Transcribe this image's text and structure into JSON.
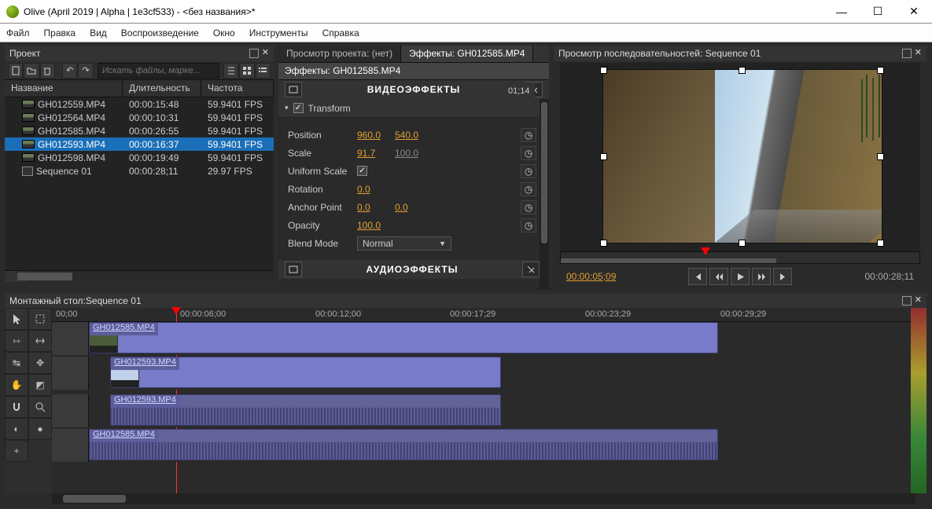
{
  "window": {
    "title": "Olive (April 2019 | Alpha | 1e3cf533) - <без названия>*"
  },
  "menu": [
    "Файл",
    "Правка",
    "Вид",
    "Воспроизведение",
    "Окно",
    "Инструменты",
    "Справка"
  ],
  "project": {
    "title": "Проект",
    "search_placeholder": "Искать файлы, марке...",
    "columns": [
      "Название",
      "Длительность",
      "Частота"
    ],
    "rows": [
      {
        "name": "GH012559.MP4",
        "dur": "00:00:15:48",
        "freq": "59.9401 FPS",
        "icon": "thumb",
        "sel": false
      },
      {
        "name": "GH012564.MP4",
        "dur": "00:00:10:31",
        "freq": "59.9401 FPS",
        "icon": "thumb",
        "sel": false
      },
      {
        "name": "GH012585.MP4",
        "dur": "00:00:26:55",
        "freq": "59.9401 FPS",
        "icon": "thumb",
        "sel": false
      },
      {
        "name": "GH012593.MP4",
        "dur": "00:00:16:37",
        "freq": "59.9401 FPS",
        "icon": "thumb",
        "sel": true
      },
      {
        "name": "GH012598.MP4",
        "dur": "00:00:19:49",
        "freq": "59.9401 FPS",
        "icon": "thumb",
        "sel": false
      },
      {
        "name": "Sequence 01",
        "dur": "00:00:28;11",
        "freq": "29.97 FPS",
        "icon": "seq",
        "sel": false
      }
    ]
  },
  "effects": {
    "tab_inactive": "Просмотр проекта: (нет)",
    "tab_active": "Эффекты: GH012585.MP4",
    "subtitle": "Эффекты: GH012585.MP4",
    "section_video": "ВИДЕОЭФФЕКТЫ",
    "transform": "Transform",
    "section_audio": "АУДИОЭФФЕКТЫ",
    "props": {
      "position": {
        "lab": "Position",
        "a": "960.0",
        "b": "540.0"
      },
      "scale": {
        "lab": "Scale",
        "a": "91.7",
        "b": "100.0"
      },
      "uniform": {
        "lab": "Uniform Scale"
      },
      "rotation": {
        "lab": "Rotation",
        "a": "0.0"
      },
      "anchor": {
        "lab": "Anchor Point",
        "a": "0.0",
        "b": "0.0"
      },
      "opacity": {
        "lab": "Opacity",
        "a": "100.0"
      },
      "blend": {
        "lab": "Blend Mode",
        "val": "Normal"
      }
    },
    "side_tc": "01;14"
  },
  "viewer": {
    "title": "Просмотр последовательностей: Sequence 01",
    "time_left": "00:00:05;09",
    "time_right": "00:00:28;11"
  },
  "timeline": {
    "title": "Монтажный стол:Sequence 01",
    "ticks": [
      "00;00",
      "00:00:06;00",
      "00:00:12;00",
      "00:00:17;29",
      "00:00:23;29",
      "00:00:29;29"
    ],
    "clips": [
      {
        "name": "GH012585.MP4"
      },
      {
        "name": "GH012593.MP4"
      },
      {
        "name": "GH012593.MP4"
      },
      {
        "name": "GH012585.MP4"
      }
    ]
  }
}
